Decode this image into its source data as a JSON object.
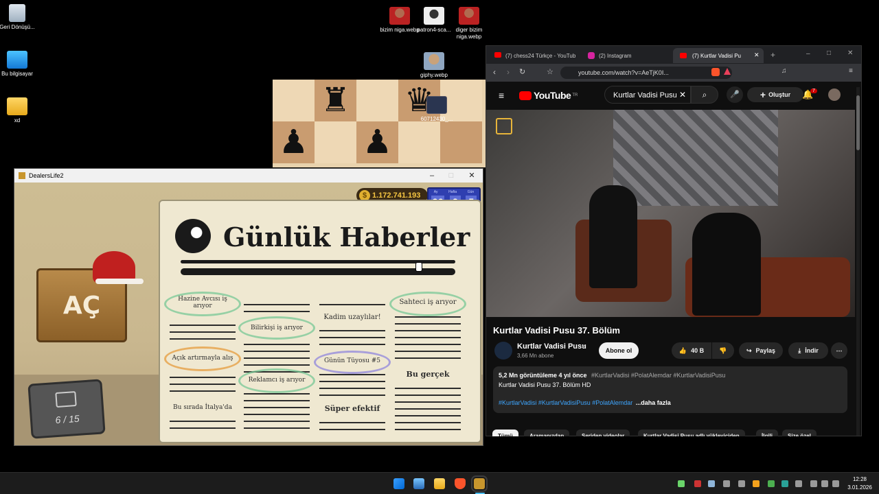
{
  "desktop": {
    "icons": [
      {
        "label": "Geri Dönüşü..."
      },
      {
        "label": "Bu bilgisayar"
      },
      {
        "label": "xd"
      },
      {
        "label": "bizim niga.webp"
      },
      {
        "label": "patron4-sca..."
      },
      {
        "label": "diger bizim niga.webp"
      },
      {
        "label": "giphy.webp"
      },
      {
        "label": "60712430_..."
      }
    ]
  },
  "game": {
    "window_title": "DealersLife2",
    "money": "1.172.741.193",
    "date_labels": [
      "Ay",
      "Hafta",
      "Gün"
    ],
    "date_values": [
      "96",
      "2",
      "5"
    ],
    "open_label": "AÇ",
    "counter": "6 / 15",
    "newspaper": {
      "title": "Günlük Haberler",
      "items": [
        "Hazine Avcısı iş arıyor",
        "Kadim uzaylılar!",
        "Sahteci iş arıyor",
        "Bilirkişi iş arıyor",
        "Açık artırmayla alış",
        "Günün Tüyosu #5",
        "Bu gerçek",
        "Reklamcı iş arıyor",
        "Bu sırada İtalya'da",
        "Süper efektif"
      ]
    }
  },
  "browser": {
    "tabs": [
      {
        "label": "(7) chess24 Türkçe - YouTub"
      },
      {
        "label": "(2) Instagram"
      },
      {
        "label": "(7) Kurtlar Vadisi Pu"
      }
    ],
    "url": "youtube.com/watch?v=AeTjK0I...",
    "youtube": {
      "logo": "YouTube",
      "region": "TR",
      "search_value": "Kurtlar Vadisi Pusu",
      "create_label": "Oluştur",
      "notif_count": "7",
      "video_title": "Kurtlar Vadisi Pusu 37. Bölüm",
      "channel_name": "Kurtlar Vadisi Pusu",
      "subscribers": "3,66 Mn abone",
      "subscribe_label": "Abone ol",
      "likes": "40 B",
      "share_label": "Paylaş",
      "download_label": "İndir",
      "description_stats": "5,2 Mn görüntüleme  4 yıl önce",
      "description_tags_inline": "#KurtlarVadisi #PolatAlemdar #KurtlarVadisiPusu",
      "description_line": "Kurtlar Vadisi Pusu 37. Bölüm HD",
      "description_hashtags": "#KurtlarVadisi #KurtlarVadisiPusu #PolatAlemdar",
      "more_label": "...daha fazla",
      "chips": [
        "Tümü",
        "Aramanızdan",
        "Seriden videolar",
        "Kurtlar Vadisi Pusu adlı yükleyiciden",
        "İlgili",
        "Size özel"
      ]
    }
  },
  "taskbar": {
    "time": "12:28",
    "date": "3.01.2026"
  },
  "colors": {
    "youtube_red": "#ff0000",
    "newspaper_paper": "#efe8d1",
    "money_gold": "#f5c542"
  }
}
